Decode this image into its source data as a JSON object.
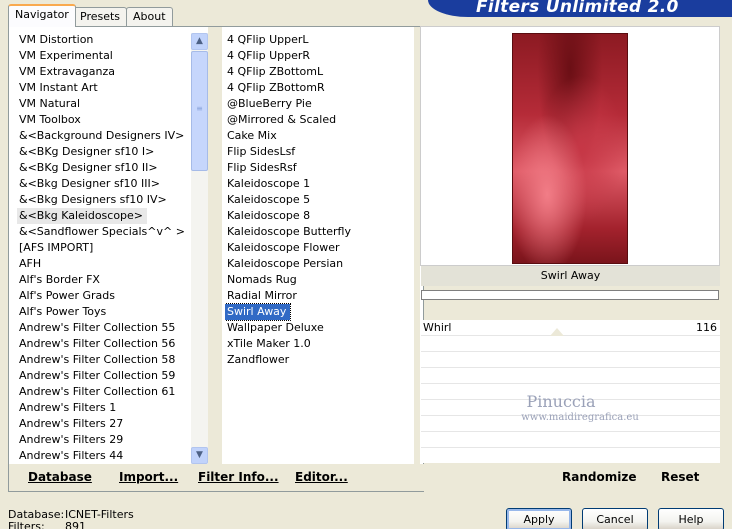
{
  "app_title": "Filters Unlimited 2.0",
  "tabs": [
    {
      "label": "Navigator"
    },
    {
      "label": "Presets"
    },
    {
      "label": "About"
    }
  ],
  "categories": [
    "VM Distortion",
    "VM Experimental",
    "VM Extravaganza",
    "VM Instant Art",
    "VM Natural",
    "VM Toolbox",
    "&<Background Designers IV>",
    "&<BKg Designer sf10 I>",
    "&<BKg Designer sf10 II>",
    "&<Bkg Designer sf10 III>",
    "&<Bkg Designers sf10 IV>",
    "&<Bkg Kaleidoscope>",
    "&<Sandflower Specials^v^ >",
    "[AFS IMPORT]",
    "AFH",
    "Alf's Border FX",
    "Alf's Power Grads",
    "Alf's Power Toys",
    "Andrew's Filter Collection 55",
    "Andrew's Filter Collection 56",
    "Andrew's Filter Collection 58",
    "Andrew's Filter Collection 59",
    "Andrew's Filter Collection 61",
    "Andrew's Filters 1",
    "Andrew's Filters 27",
    "Andrew's Filters 29",
    "Andrew's Filters 44"
  ],
  "filters": [
    "4 QFlip UpperL",
    "4 QFlip UpperR",
    "4 QFlip ZBottomL",
    "4 QFlip ZBottomR",
    "@BlueBerry Pie",
    "@Mirrored & Scaled",
    "Cake Mix",
    "Flip SidesLsf",
    "Flip SidesRsf",
    "Kaleidoscope 1",
    "Kaleidoscope 5",
    "Kaleidoscope 8",
    "Kaleidoscope Butterfly",
    "Kaleidoscope Flower",
    "Kaleidoscope Persian",
    "Nomads Rug",
    "Radial Mirror",
    "Swirl Away",
    "Wallpaper Deluxe",
    "xTile Maker 1.0",
    "Zandflower"
  ],
  "left_buttons": {
    "database": "Database",
    "import": "Import...",
    "filter_info": "Filter Info...",
    "editor": "Editor..."
  },
  "right_buttons": {
    "randomize": "Randomize",
    "reset": "Reset"
  },
  "preview": {
    "filter_name": "Swirl Away",
    "progress_fraction": 0.0
  },
  "params": [
    {
      "label": "Whirl",
      "value": "116"
    }
  ],
  "watermark": {
    "name": "Pinuccia",
    "url": "www.maidiregrafica.eu"
  },
  "status": {
    "database_label": "Database:",
    "database_value": "ICNET-Filters",
    "filters_label": "Filters:",
    "filters_value": "891"
  },
  "dialog_buttons": {
    "apply": "Apply",
    "cancel": "Cancel",
    "help": "Help"
  },
  "colors": {
    "banner": "#1a3d9e",
    "selection": "#316ac5"
  }
}
